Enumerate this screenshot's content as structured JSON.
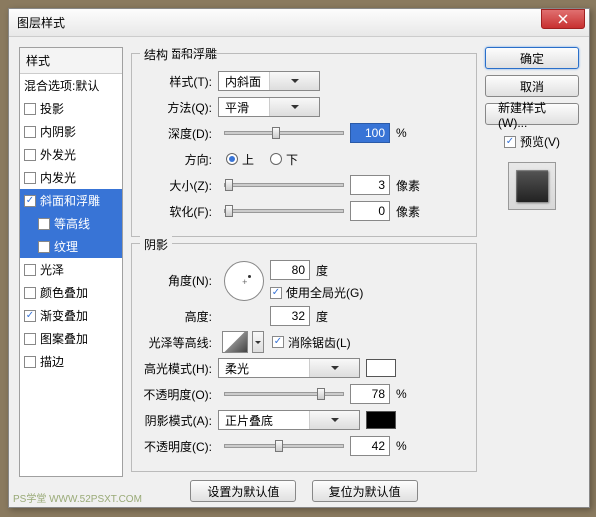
{
  "title": "图层样式",
  "styles": {
    "header": "样式",
    "blend": "混合选项:默认",
    "items": [
      {
        "label": "投影",
        "checked": false
      },
      {
        "label": "内阴影",
        "checked": false
      },
      {
        "label": "外发光",
        "checked": false
      },
      {
        "label": "内发光",
        "checked": false
      },
      {
        "label": "斜面和浮雕",
        "checked": true,
        "selected": true
      },
      {
        "label": "等高线",
        "checked": false,
        "sub": true,
        "selected": true
      },
      {
        "label": "纹理",
        "checked": false,
        "sub": true,
        "selected": true
      },
      {
        "label": "光泽",
        "checked": false
      },
      {
        "label": "颜色叠加",
        "checked": false
      },
      {
        "label": "渐变叠加",
        "checked": true
      },
      {
        "label": "图案叠加",
        "checked": false
      },
      {
        "label": "描边",
        "checked": false
      }
    ]
  },
  "panel_title": "斜面和浮雕",
  "structure": {
    "legend": "结构",
    "style_lbl": "样式(T):",
    "style_val": "内斜面",
    "technique_lbl": "方法(Q):",
    "technique_val": "平滑",
    "depth_lbl": "深度(D):",
    "depth_val": "100",
    "depth_unit": "%",
    "direction_lbl": "方向:",
    "dir_up": "上",
    "dir_down": "下",
    "size_lbl": "大小(Z):",
    "size_val": "3",
    "size_unit": "像素",
    "soften_lbl": "软化(F):",
    "soften_val": "0",
    "soften_unit": "像素"
  },
  "shading": {
    "legend": "阴影",
    "angle_lbl": "角度(N):",
    "angle_val": "80",
    "angle_unit": "度",
    "global_light": "使用全局光(G)",
    "altitude_lbl": "高度:",
    "altitude_val": "32",
    "altitude_unit": "度",
    "gloss_lbl": "光泽等高线:",
    "antialias": "消除锯齿(L)",
    "highlight_mode_lbl": "高光模式(H):",
    "highlight_mode_val": "柔光",
    "highlight_color": "#ffffff",
    "highlight_opacity_lbl": "不透明度(O):",
    "highlight_opacity_val": "78",
    "opacity_unit": "%",
    "shadow_mode_lbl": "阴影模式(A):",
    "shadow_mode_val": "正片叠底",
    "shadow_color": "#000000",
    "shadow_opacity_lbl": "不透明度(C):",
    "shadow_opacity_val": "42"
  },
  "buttons": {
    "ok": "确定",
    "cancel": "取消",
    "new_style": "新建样式(W)...",
    "preview": "预览(V)",
    "make_default": "设置为默认值",
    "reset_default": "复位为默认值"
  },
  "watermark": "PS学堂  WWW.52PSXT.COM"
}
